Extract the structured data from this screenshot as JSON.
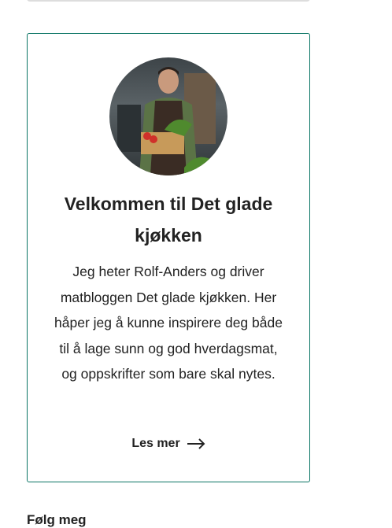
{
  "card": {
    "title": "Velkommen til Det glade kjøkken",
    "text": "Jeg heter Rolf-Anders og driver matbloggen Det glade kjøkken. Her håper jeg å kunne inspirere deg både til å lage sunn og god hverdagsmat, og oppskrifter som bare skal nytes.",
    "read_more": "Les mer",
    "accent": "#0b7565"
  },
  "follow_heading": "Følg meg"
}
